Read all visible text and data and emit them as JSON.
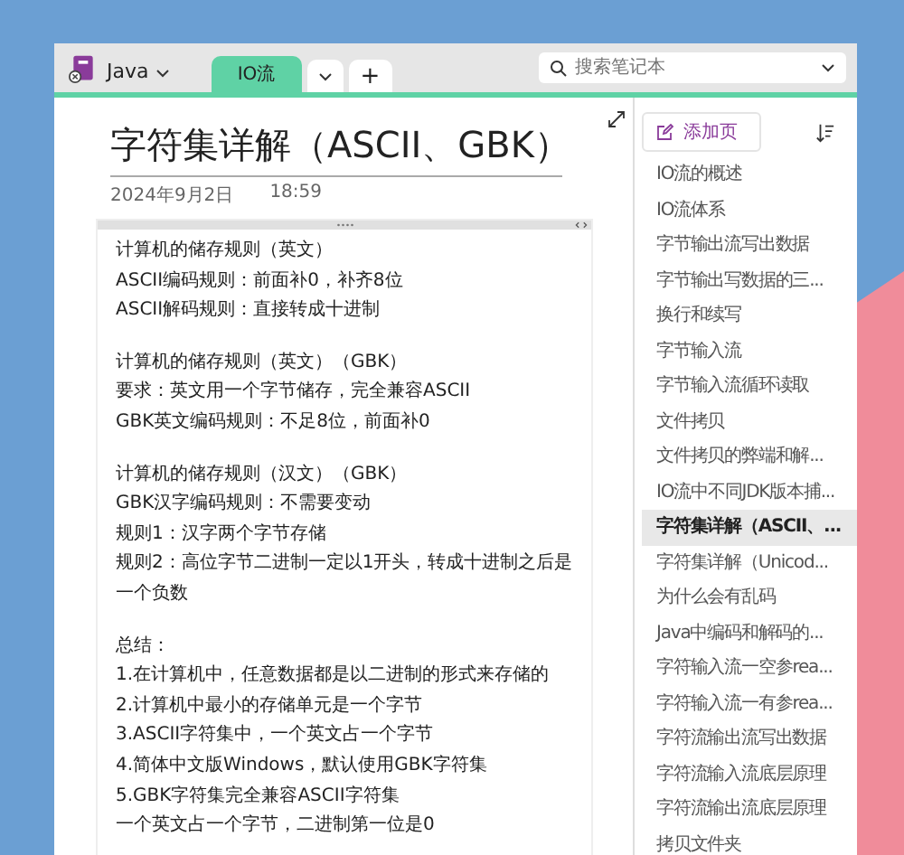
{
  "header": {
    "notebook": "Java",
    "tabs": [
      {
        "label": "IO流",
        "selected": true
      }
    ],
    "add_tab": "+",
    "search": {
      "placeholder": "搜索笔记本"
    }
  },
  "page": {
    "title": "字符集详解（ASCII、GBK）",
    "date": "2024年9月2日",
    "time": "18:59",
    "paragraphs": [
      [
        "计算机的储存规则（英文）",
        "ASCII编码规则：前面补0，补齐8位",
        "ASCII解码规则：直接转成十进制"
      ],
      [
        "计算机的储存规则（英文）（GBK）",
        "要求：英文用一个字节储存，完全兼容ASCII",
        "GBK英文编码规则：不足8位，前面补0"
      ],
      [
        "计算机的储存规则（汉文）（GBK）",
        "GBK汉字编码规则：不需要变动",
        "规则1：汉字两个字节存储",
        "规则2：高位字节二进制一定以1开头，转成十进制之后是一个负数"
      ],
      [
        "总结：",
        "1.在计算机中，任意数据都是以二进制的形式来存储的",
        "2.计算机中最小的存储单元是一个字节",
        "3.ASCII字符集中，一个英文占一个字节",
        "4.简体中文版Windows，默认使用GBK字符集",
        "5.GBK字符集完全兼容ASCII字符集",
        "一个英文占一个字节，二进制第一位是0"
      ]
    ]
  },
  "pages_panel": {
    "add_page": "添加页",
    "pages": [
      {
        "title": "IO流的概述",
        "selected": false
      },
      {
        "title": "IO流体系",
        "selected": false
      },
      {
        "title": "字节输出流写出数据",
        "selected": false
      },
      {
        "title": "字节输出写数据的三...",
        "selected": false
      },
      {
        "title": "换行和续写",
        "selected": false
      },
      {
        "title": "字节输入流",
        "selected": false
      },
      {
        "title": "字节输入流循环读取",
        "selected": false
      },
      {
        "title": "文件拷贝",
        "selected": false
      },
      {
        "title": "文件拷贝的弊端和解...",
        "selected": false
      },
      {
        "title": "IO流中不同JDK版本捕...",
        "selected": false
      },
      {
        "title": "字符集详解（ASCII、...",
        "selected": true
      },
      {
        "title": "字符集详解（Unicod...",
        "selected": false
      },
      {
        "title": "为什么会有乱码",
        "selected": false
      },
      {
        "title": "Java中编码和解码的...",
        "selected": false
      },
      {
        "title": "字符输入流一空参rea...",
        "selected": false
      },
      {
        "title": "字符输入流一有参rea...",
        "selected": false
      },
      {
        "title": "字符流输出流写出数据",
        "selected": false
      },
      {
        "title": "字符流输入流底层原理",
        "selected": false
      },
      {
        "title": "字符流输出流底层原理",
        "selected": false
      },
      {
        "title": "拷贝文件夹",
        "selected": false
      }
    ]
  }
}
